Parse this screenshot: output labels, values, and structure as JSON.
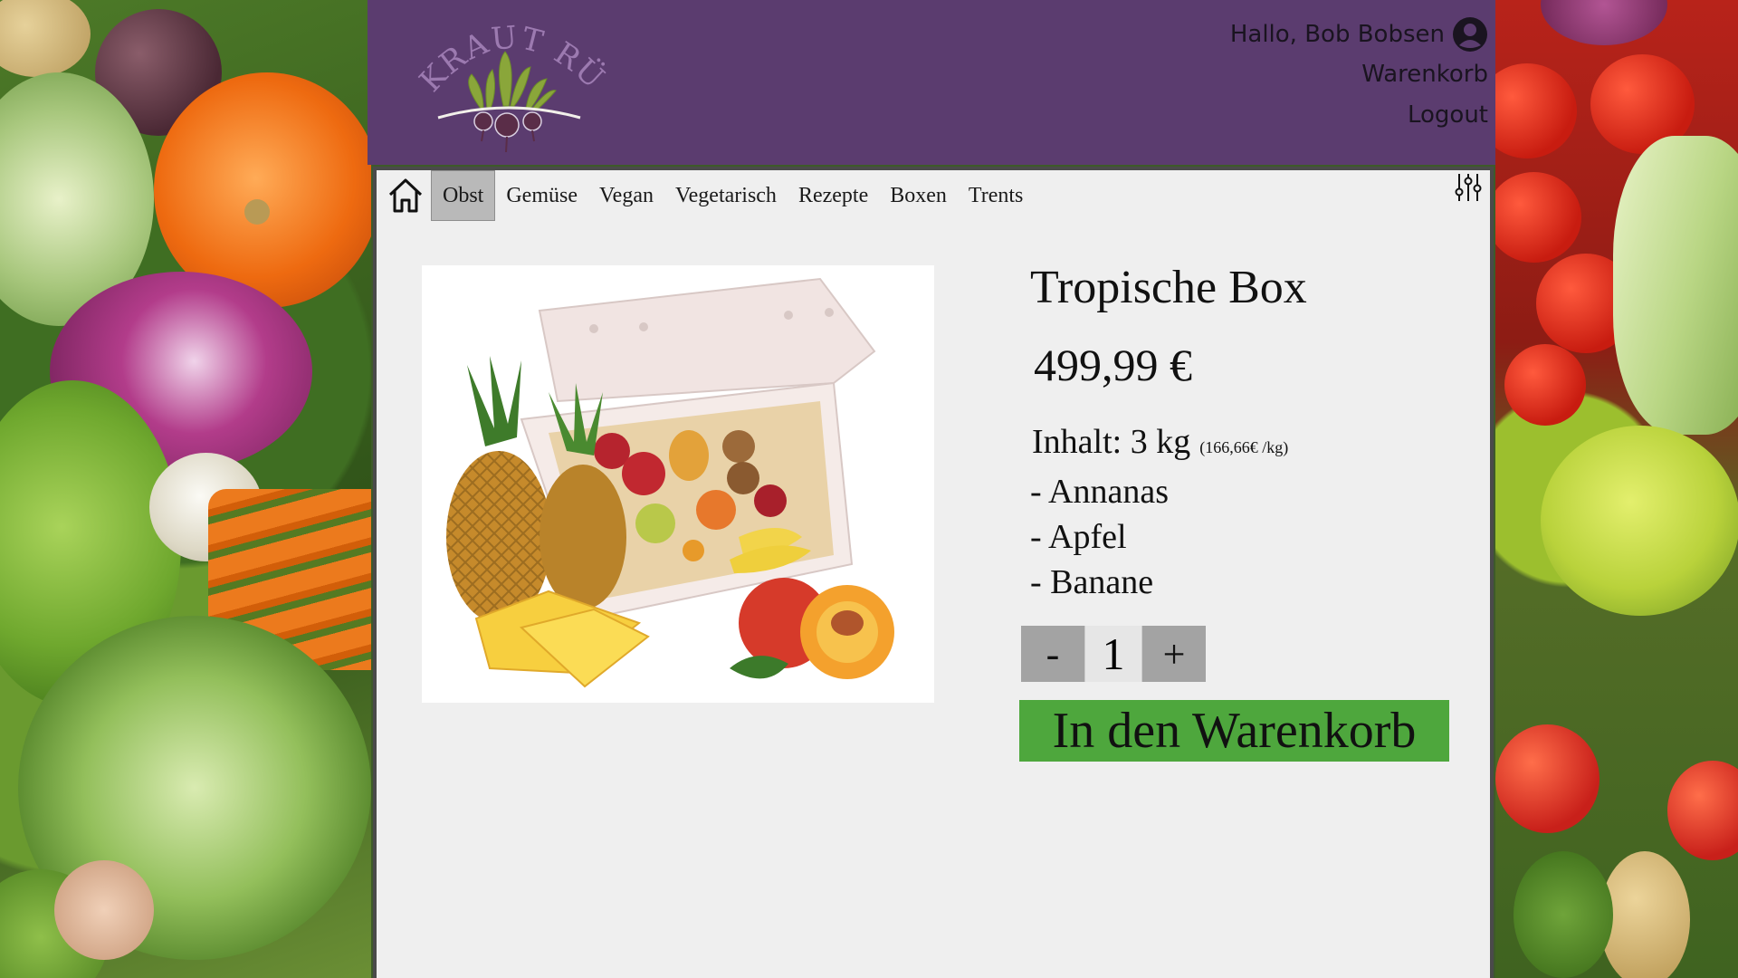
{
  "header": {
    "logo_text": "KRAUT RÜBEN",
    "greeting": "Hallo, Bob Bobsen",
    "cart_link": "Warenkorb",
    "logout_link": "Logout"
  },
  "nav": {
    "items": [
      {
        "label": "Obst",
        "active": true
      },
      {
        "label": "Gemüse"
      },
      {
        "label": "Vegan"
      },
      {
        "label": "Vegetarisch"
      },
      {
        "label": "Rezepte"
      },
      {
        "label": "Boxen"
      },
      {
        "label": "Trents"
      }
    ]
  },
  "product": {
    "title": "Tropische Box",
    "price": "499,99 €",
    "content_label": "Inhalt: 3 kg",
    "price_per_kg": "(166,66€ /kg)",
    "items": [
      "- Annanas",
      "- Apfel",
      "- Banane"
    ]
  },
  "stepper": {
    "minus": "-",
    "quantity": "1",
    "plus": "+"
  },
  "cart_button": "In den Warenkorb",
  "colors": {
    "header_bg": "#5b3c6f",
    "panel_bg": "#efefef",
    "cart_button_bg": "#4ea73d",
    "nav_active_bg": "#b9b9b9"
  }
}
